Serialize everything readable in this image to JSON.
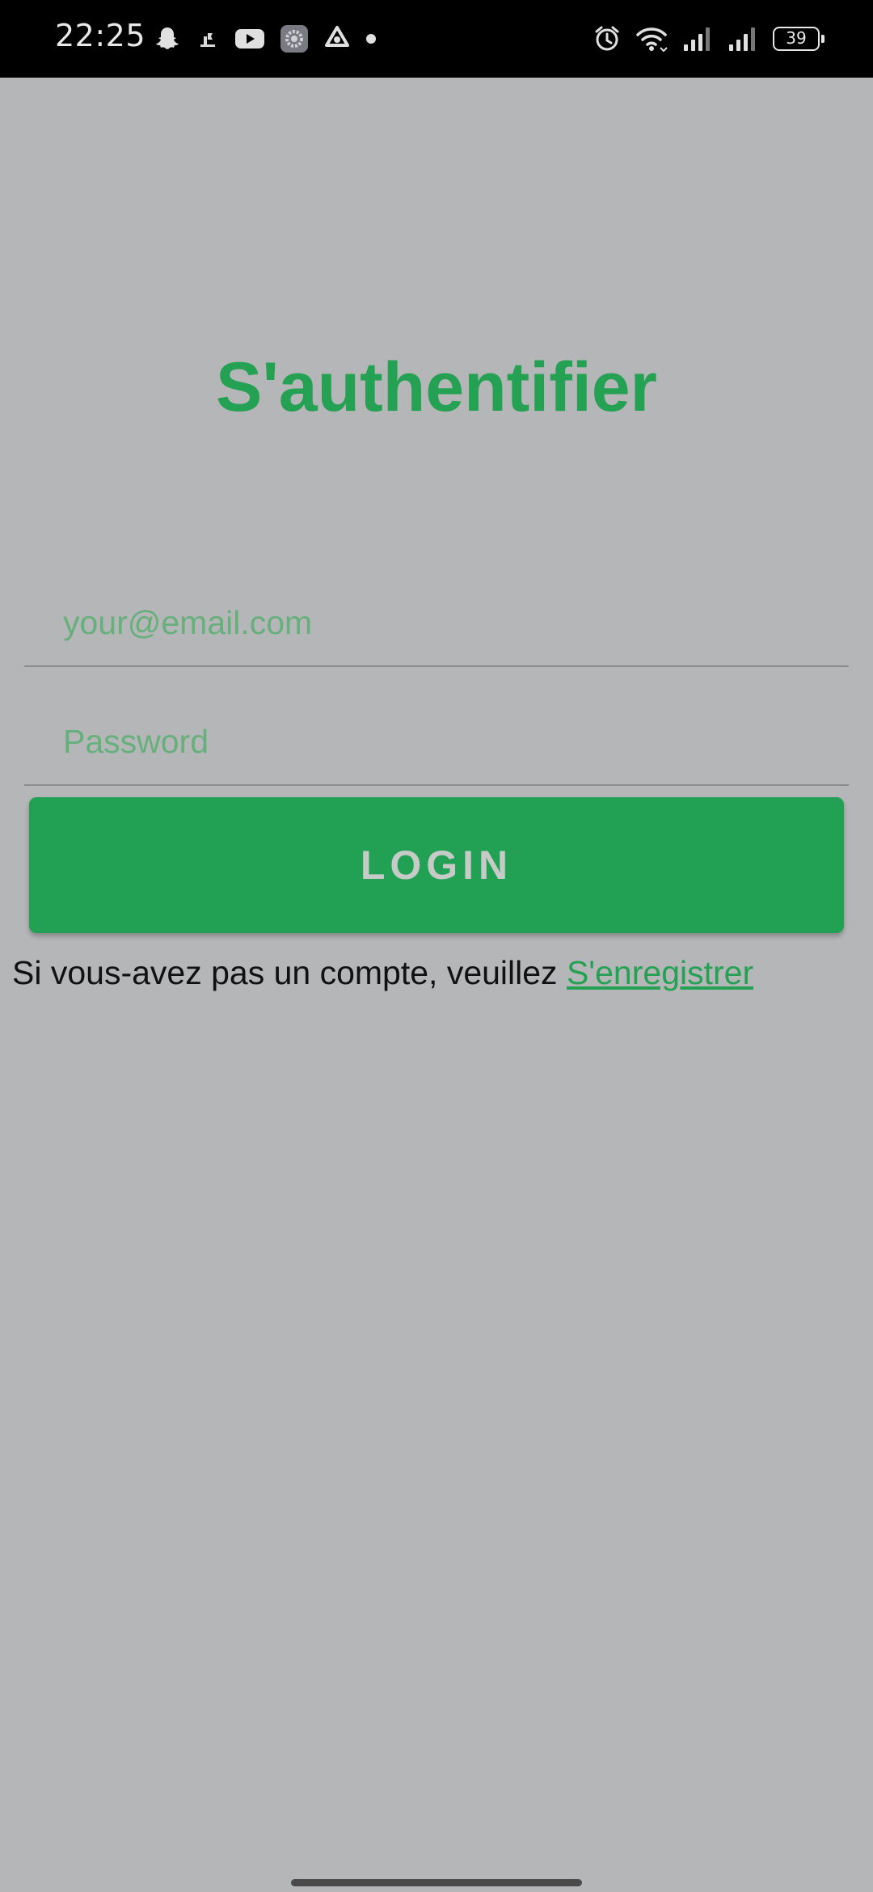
{
  "status_bar": {
    "time": "22:25",
    "battery": "39",
    "left_icons": [
      "snapchat-icon",
      "notification-icon",
      "youtube-icon",
      "settings-app-icon",
      "recycle-icon",
      "dot-icon"
    ],
    "right_icons": [
      "alarm-icon",
      "wifi-icon",
      "signal-icon",
      "signal-icon",
      "battery-icon"
    ]
  },
  "login": {
    "title": "S'authentifier",
    "email_placeholder": "your@email.com",
    "password_placeholder": "Password",
    "button_label": "LOGIN",
    "register_prompt": "Si vous-avez pas un compte, veuillez ",
    "register_link": "S'enregistrer"
  },
  "colors": {
    "accent": "#24a152",
    "button": "#22a155",
    "background": "#b5b6b8",
    "placeholder": "#67b07c"
  }
}
